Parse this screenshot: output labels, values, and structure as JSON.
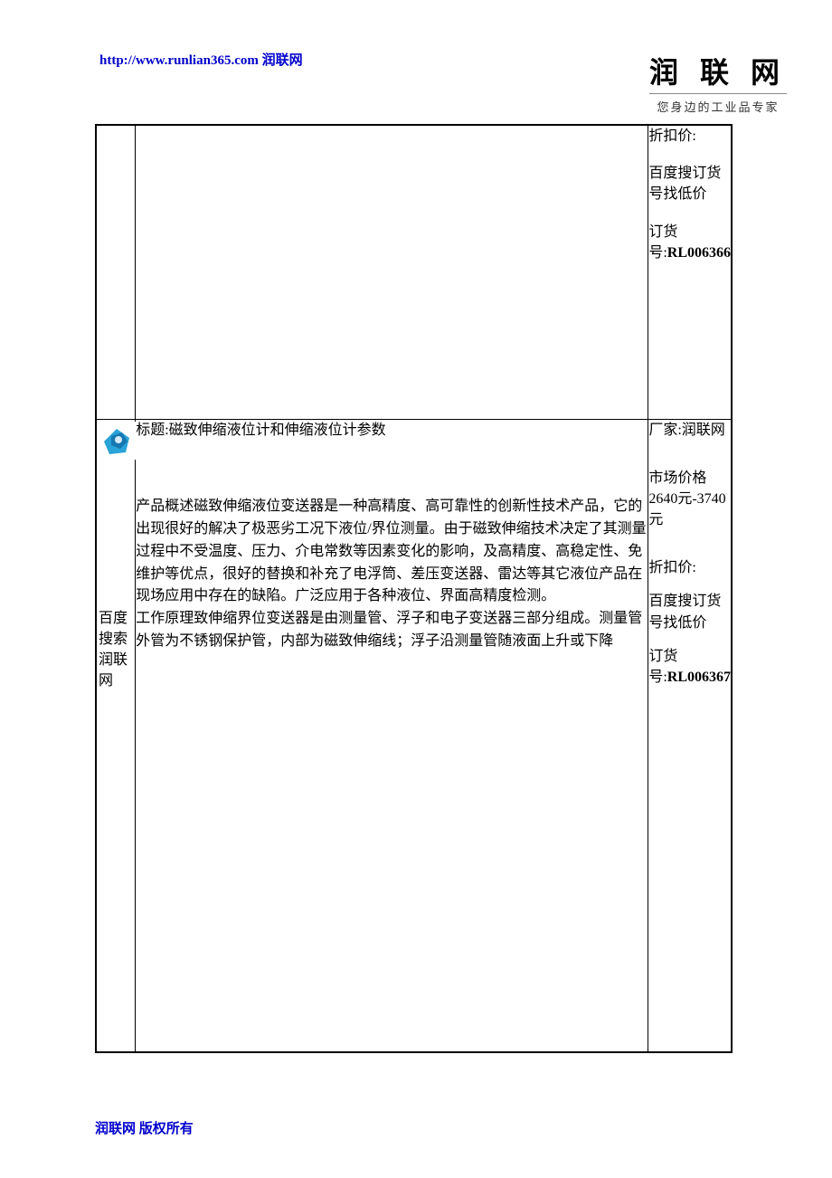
{
  "header": {
    "url": "http://www.runlian365.com",
    "site_name": "润联网"
  },
  "logo": {
    "main": "润 联 网",
    "sub": "您身边的工业品专家"
  },
  "row1": {
    "discount_label": "折扣价:",
    "baidu_tip": "百度搜订货号找低价",
    "order_label": "订货号:",
    "order_value": "RL006366"
  },
  "row2": {
    "left_search": "百度搜索润联网",
    "title_label": "标题:",
    "title_value": "磁致伸缩液位计和伸缩液位计参数",
    "desc": "产品概述磁致伸缩液位变送器是一种高精度、高可靠性的创新性技术产品，它的出现很好的解决了极恶劣工况下液位/界位测量。由于磁致伸缩技术决定了其测量过程中不受温度、压力、介电常数等因素变化的影响，及高精度、高稳定性、免维护等优点，很好的替换和补充了电浮筒、差压变送器、雷达等其它液位产品在现场应用中存在的缺陷。广泛应用于各种液位、界面高精度检测。",
    "principle": "工作原理致伸缩界位变送器是由测量管、浮子和电子变送器三部分组成。测量管外管为不锈钢保护管，内部为磁致伸缩线；浮子沿测量管随液面上升或下降",
    "maker_label": "厂家:",
    "maker_value": "润联网",
    "price_label": "市场价格",
    "price_value": "2640元-3740元",
    "discount_label": "折扣价:",
    "baidu_tip": "百度搜订货号找低价",
    "order_label": "订货号:",
    "order_value": "RL006367"
  },
  "footer": {
    "copyright": "润联网 版权所有"
  }
}
